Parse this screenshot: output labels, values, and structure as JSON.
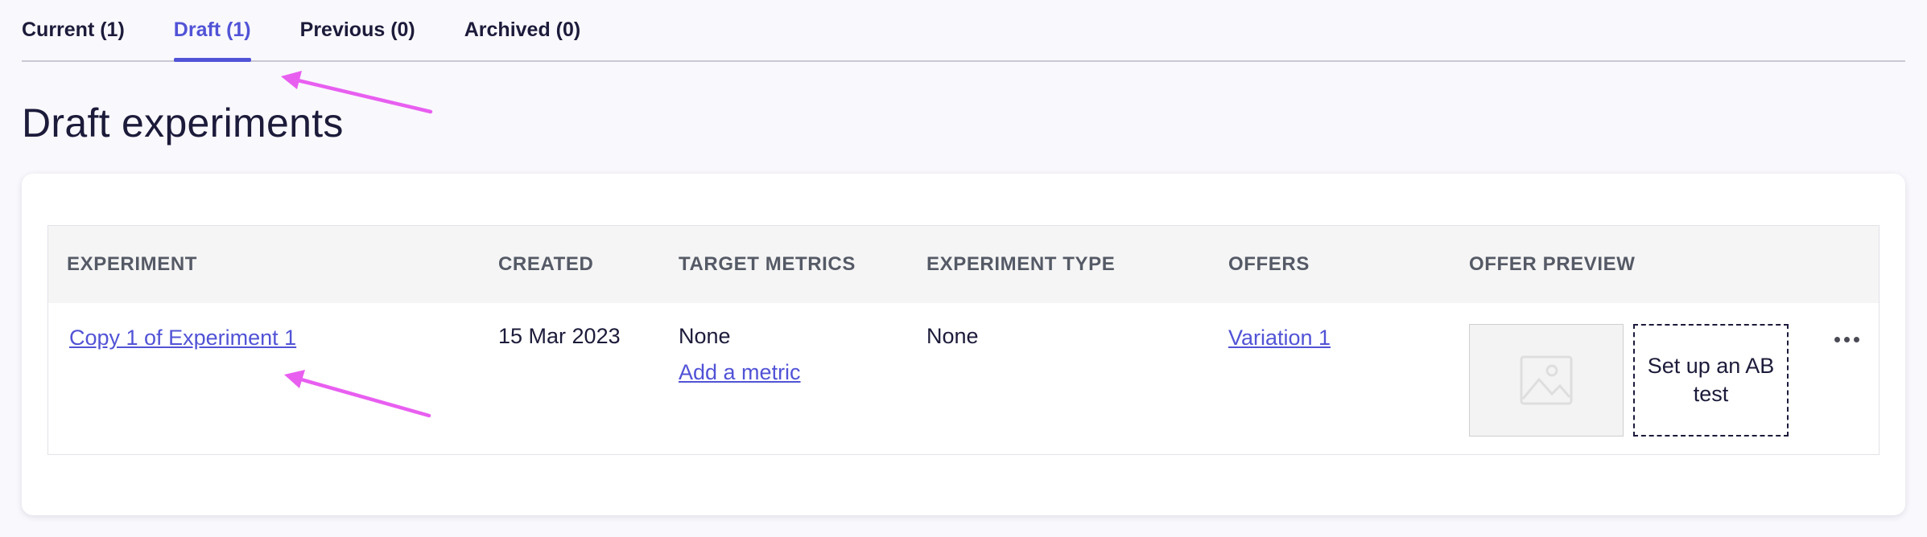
{
  "tabs": [
    {
      "label": "Current (1)",
      "active": false
    },
    {
      "label": "Draft (1)",
      "active": true
    },
    {
      "label": "Previous (0)",
      "active": false
    },
    {
      "label": "Archived (0)",
      "active": false
    }
  ],
  "page_title": "Draft experiments",
  "table": {
    "headers": {
      "experiment": "EXPERIMENT",
      "created": "CREATED",
      "target_metrics": "TARGET METRICS",
      "experiment_type": "EXPERIMENT TYPE",
      "offers": "OFFERS",
      "offer_preview": "OFFER PREVIEW"
    },
    "rows": [
      {
        "experiment": "Copy 1 of Experiment 1",
        "created": "15 Mar 2023",
        "target_metrics": "None",
        "add_metric": "Add a metric",
        "experiment_type": "None",
        "offers": "Variation 1",
        "ab_test": "Set up an AB test"
      }
    ]
  },
  "colors": {
    "accent": "#5153d6",
    "annotation_arrow": "#e85ff0"
  }
}
